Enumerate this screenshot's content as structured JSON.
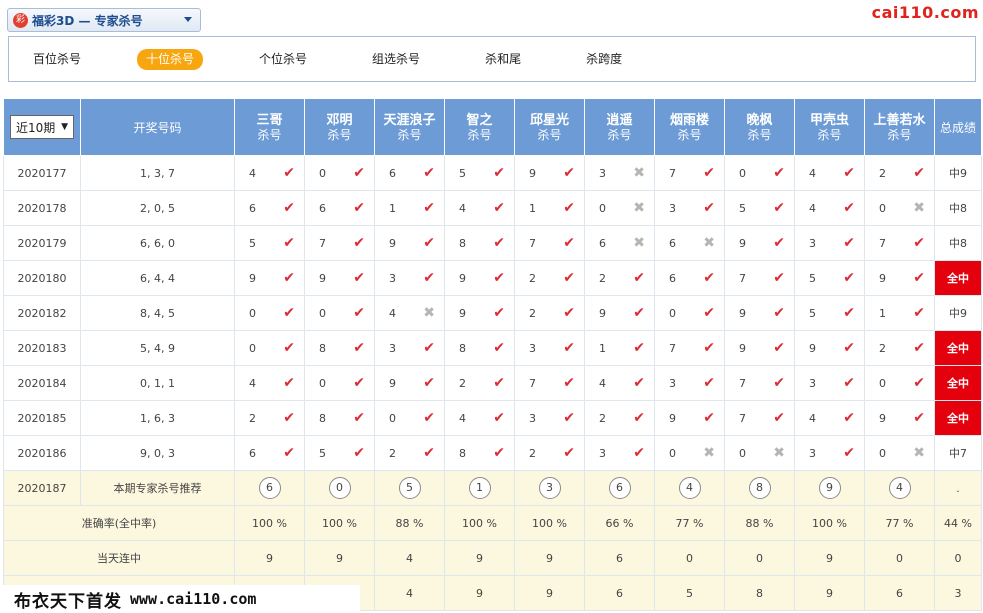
{
  "header": {
    "logo_badge": "彩",
    "lottery_title": "福彩3D — 专家杀号",
    "site_logo": "cai110.com"
  },
  "tabs": [
    {
      "label": "百位杀号",
      "active": false
    },
    {
      "label": "十位杀号",
      "active": true
    },
    {
      "label": "个位杀号",
      "active": false
    },
    {
      "label": "组选杀号",
      "active": false
    },
    {
      "label": "杀和尾",
      "active": false
    },
    {
      "label": "杀跨度",
      "active": false
    }
  ],
  "table": {
    "period_select": "近10期",
    "draw_header": "开奖号码",
    "total_header": "总成绩",
    "expert_sub": "杀号",
    "experts": [
      "三哥",
      "邓明",
      "天涯浪子",
      "智之",
      "邱星光",
      "逍遥",
      "烟雨楼",
      "晚枫",
      "甲壳虫",
      "上善若水"
    ],
    "rows": [
      {
        "issue": "2020177",
        "draw": "1, 3, 7",
        "total": "中9",
        "full": false,
        "cells": [
          [
            "4",
            "hit"
          ],
          [
            "0",
            "hit"
          ],
          [
            "6",
            "hit"
          ],
          [
            "5",
            "hit"
          ],
          [
            "9",
            "hit"
          ],
          [
            "3",
            "miss"
          ],
          [
            "7",
            "hit"
          ],
          [
            "0",
            "hit"
          ],
          [
            "4",
            "hit"
          ],
          [
            "2",
            "hit"
          ]
        ]
      },
      {
        "issue": "2020178",
        "draw": "2, 0, 5",
        "total": "中8",
        "full": false,
        "cells": [
          [
            "6",
            "hit"
          ],
          [
            "6",
            "hit"
          ],
          [
            "1",
            "hit"
          ],
          [
            "4",
            "hit"
          ],
          [
            "1",
            "hit"
          ],
          [
            "0",
            "miss"
          ],
          [
            "3",
            "hit"
          ],
          [
            "5",
            "hit"
          ],
          [
            "4",
            "hit"
          ],
          [
            "0",
            "miss"
          ]
        ]
      },
      {
        "issue": "2020179",
        "draw": "6, 6, 0",
        "total": "中8",
        "full": false,
        "cells": [
          [
            "5",
            "hit"
          ],
          [
            "7",
            "hit"
          ],
          [
            "9",
            "hit"
          ],
          [
            "8",
            "hit"
          ],
          [
            "7",
            "hit"
          ],
          [
            "6",
            "miss"
          ],
          [
            "6",
            "miss"
          ],
          [
            "9",
            "hit"
          ],
          [
            "3",
            "hit"
          ],
          [
            "7",
            "hit"
          ]
        ]
      },
      {
        "issue": "2020180",
        "draw": "6, 4, 4",
        "total": "全中",
        "full": true,
        "cells": [
          [
            "9",
            "hit"
          ],
          [
            "9",
            "hit"
          ],
          [
            "3",
            "hit"
          ],
          [
            "9",
            "hit"
          ],
          [
            "2",
            "hit"
          ],
          [
            "2",
            "hit"
          ],
          [
            "6",
            "hit"
          ],
          [
            "7",
            "hit"
          ],
          [
            "5",
            "hit"
          ],
          [
            "9",
            "hit"
          ]
        ]
      },
      {
        "issue": "2020182",
        "draw": "8, 4, 5",
        "total": "中9",
        "full": false,
        "cells": [
          [
            "0",
            "hit"
          ],
          [
            "0",
            "hit"
          ],
          [
            "4",
            "miss"
          ],
          [
            "9",
            "hit"
          ],
          [
            "2",
            "hit"
          ],
          [
            "9",
            "hit"
          ],
          [
            "0",
            "hit"
          ],
          [
            "9",
            "hit"
          ],
          [
            "5",
            "hit"
          ],
          [
            "1",
            "hit"
          ]
        ]
      },
      {
        "issue": "2020183",
        "draw": "5, 4, 9",
        "total": "全中",
        "full": true,
        "cells": [
          [
            "0",
            "hit"
          ],
          [
            "8",
            "hit"
          ],
          [
            "3",
            "hit"
          ],
          [
            "8",
            "hit"
          ],
          [
            "3",
            "hit"
          ],
          [
            "1",
            "hit"
          ],
          [
            "7",
            "hit"
          ],
          [
            "9",
            "hit"
          ],
          [
            "9",
            "hit"
          ],
          [
            "2",
            "hit"
          ]
        ]
      },
      {
        "issue": "2020184",
        "draw": "0, 1, 1",
        "total": "全中",
        "full": true,
        "cells": [
          [
            "4",
            "hit"
          ],
          [
            "0",
            "hit"
          ],
          [
            "9",
            "hit"
          ],
          [
            "2",
            "hit"
          ],
          [
            "7",
            "hit"
          ],
          [
            "4",
            "hit"
          ],
          [
            "3",
            "hit"
          ],
          [
            "7",
            "hit"
          ],
          [
            "3",
            "hit"
          ],
          [
            "0",
            "hit"
          ]
        ]
      },
      {
        "issue": "2020185",
        "draw": "1, 6, 3",
        "total": "全中",
        "full": true,
        "cells": [
          [
            "2",
            "hit"
          ],
          [
            "8",
            "hit"
          ],
          [
            "0",
            "hit"
          ],
          [
            "4",
            "hit"
          ],
          [
            "3",
            "hit"
          ],
          [
            "2",
            "hit"
          ],
          [
            "9",
            "hit"
          ],
          [
            "7",
            "hit"
          ],
          [
            "4",
            "hit"
          ],
          [
            "9",
            "hit"
          ]
        ]
      },
      {
        "issue": "2020186",
        "draw": "9, 0, 3",
        "total": "中7",
        "full": false,
        "cells": [
          [
            "6",
            "hit"
          ],
          [
            "5",
            "hit"
          ],
          [
            "2",
            "hit"
          ],
          [
            "8",
            "hit"
          ],
          [
            "2",
            "hit"
          ],
          [
            "3",
            "hit"
          ],
          [
            "0",
            "miss"
          ],
          [
            "0",
            "miss"
          ],
          [
            "3",
            "hit"
          ],
          [
            "0",
            "miss"
          ]
        ]
      }
    ],
    "recommend": {
      "issue": "2020187",
      "label": "本期专家杀号推荐",
      "balls": [
        "6",
        "0",
        "5",
        "1",
        "3",
        "6",
        "4",
        "8",
        "9",
        "4"
      ],
      "total": "."
    },
    "accuracy": {
      "label": "准确率(全中率)",
      "values": [
        "100 %",
        "100 %",
        "88 %",
        "100 %",
        "100 %",
        "66 %",
        "77 %",
        "88 %",
        "100 %",
        "77 %"
      ],
      "total": "44 %"
    },
    "streak": {
      "label": "当天连中",
      "values": [
        "9",
        "9",
        "4",
        "9",
        "9",
        "6",
        "0",
        "0",
        "9",
        "0"
      ],
      "total": "0"
    },
    "max_streak": {
      "label": "",
      "values": [
        "",
        "",
        "4",
        "9",
        "9",
        "6",
        "5",
        "8",
        "9",
        "6"
      ],
      "total": "3"
    }
  },
  "marks": {
    "hit": "✔",
    "miss": "✖"
  },
  "watermark": {
    "cn": "布衣天下首发",
    "url": "www.cai110.com"
  },
  "colors": {
    "header_blue": "#6c9bd6",
    "accent_orange": "#f7a60f",
    "full_hit_red": "#e5000d",
    "hit_red": "#dd2a35",
    "stat_yellow": "#fcf8df"
  }
}
